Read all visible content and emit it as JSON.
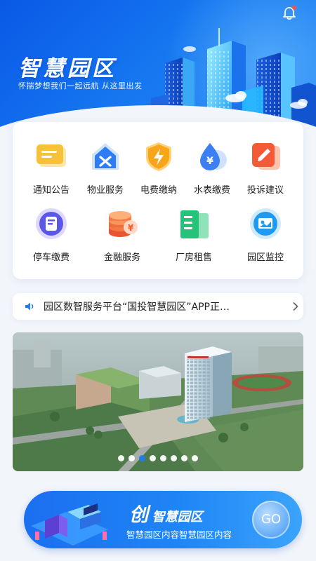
{
  "header": {
    "title": "智慧园区",
    "slogan": "怀揣梦想我们一起远航  从这里出发",
    "bell_icon": "bell-icon",
    "accent": "#1576f0"
  },
  "services": {
    "row1": [
      {
        "label": "通知公告",
        "icon": "announcement-icon"
      },
      {
        "label": "物业服务",
        "icon": "property-service-icon"
      },
      {
        "label": "电费缴纳",
        "icon": "electricity-bill-icon"
      },
      {
        "label": "水表缴费",
        "icon": "water-bill-icon"
      },
      {
        "label": "投诉建议",
        "icon": "complaint-icon"
      }
    ],
    "row2": [
      {
        "label": "停车缴费",
        "icon": "parking-fee-icon"
      },
      {
        "label": "金融服务",
        "icon": "finance-service-icon"
      },
      {
        "label": "厂房租售",
        "icon": "factory-lease-icon"
      },
      {
        "label": "园区监控",
        "icon": "park-monitor-icon"
      }
    ]
  },
  "notice": {
    "text": "园区数智服务平台“国投智慧园区”APP正…",
    "speaker_icon": "speaker-icon",
    "arrow_icon": "chevron-right-icon"
  },
  "banner": {
    "dot_count": 8,
    "active_index": 2
  },
  "cta": {
    "title_big": "创",
    "title_rest": "智慧园区",
    "subtitle": "智慧园区内容智慧园区内容",
    "go_label": "GO"
  }
}
